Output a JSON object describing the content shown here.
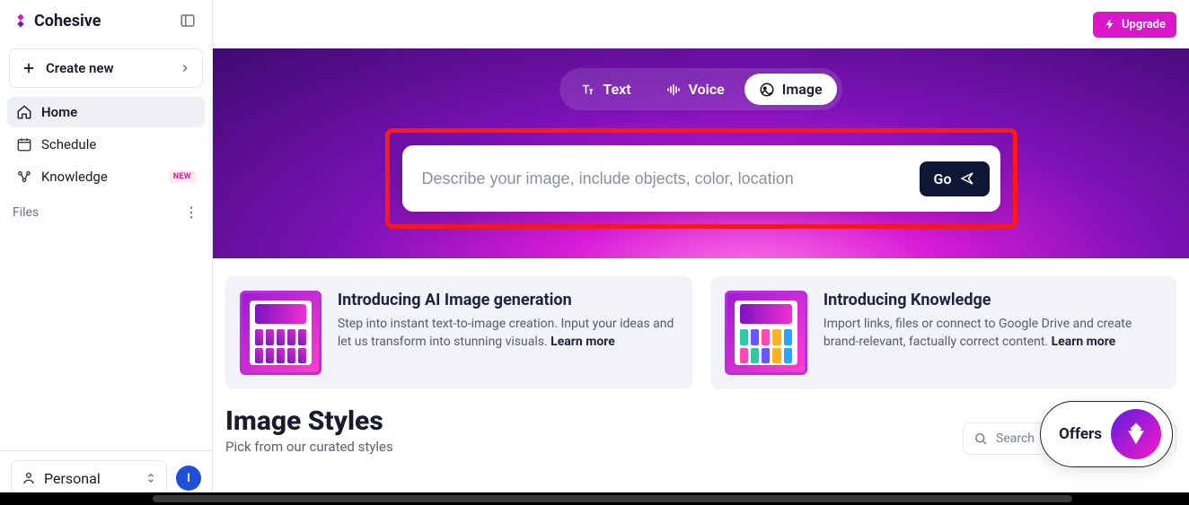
{
  "brand": "Cohesive",
  "sidebar": {
    "create_label": "Create new",
    "items": [
      {
        "label": "Home"
      },
      {
        "label": "Schedule"
      },
      {
        "label": "Knowledge",
        "badge": "NEW"
      }
    ],
    "files_label": "Files",
    "personal_label": "Personal",
    "avatar_initial": "I"
  },
  "topbar": {
    "upgrade_label": "Upgrade"
  },
  "hero": {
    "modes": [
      {
        "label": "Text"
      },
      {
        "label": "Voice"
      },
      {
        "label": "Image"
      }
    ],
    "placeholder": "Describe your image, include objects, color, location",
    "go_label": "Go"
  },
  "cards": [
    {
      "title": "Introducing AI Image generation",
      "body": "Step into instant text-to-image creation. Input your ideas and let us transform into stunning visuals. ",
      "learn": "Learn more"
    },
    {
      "title": "Introducing Knowledge",
      "body": "Import links, files or connect to Google Drive and create brand-relevant, factually correct content. ",
      "learn": "Learn more"
    }
  ],
  "styles": {
    "heading": "Image Styles",
    "sub": "Pick from our curated styles",
    "search_placeholder": "Search",
    "kbd": "/"
  },
  "offers_label": "Offers"
}
